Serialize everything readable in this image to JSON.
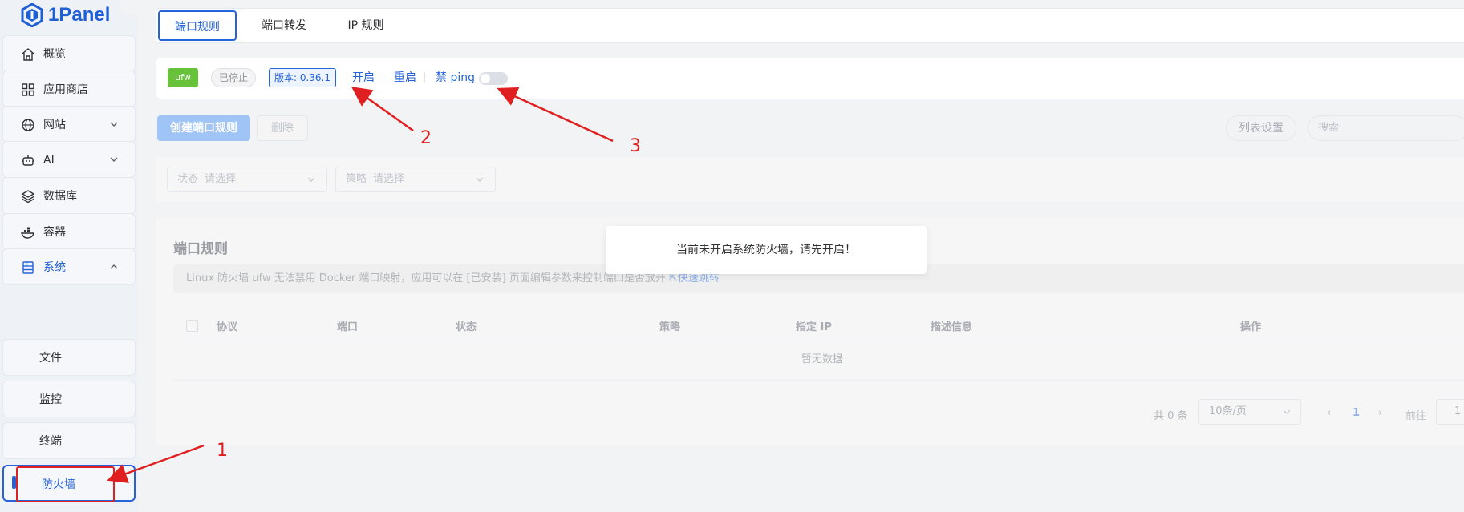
{
  "app": {
    "logo_text": "1Panel"
  },
  "colors": {
    "accent": "#2463d8",
    "success": "#67c23a",
    "annotation": "#e02020"
  },
  "sidebar": {
    "items": [
      {
        "label": "概览",
        "icon": "home-icon",
        "expandable": false
      },
      {
        "label": "应用商店",
        "icon": "grid-icon",
        "expandable": false
      },
      {
        "label": "网站",
        "icon": "globe-icon",
        "expandable": true
      },
      {
        "label": "AI",
        "icon": "robot-icon",
        "expandable": true
      },
      {
        "label": "数据库",
        "icon": "layers-icon",
        "expandable": false
      },
      {
        "label": "容器",
        "icon": "docker-icon",
        "expandable": false
      },
      {
        "label": "系统",
        "icon": "server-icon",
        "expandable": true,
        "expanded": true
      }
    ],
    "sub_items": [
      {
        "label": "文件"
      },
      {
        "label": "监控"
      },
      {
        "label": "终端"
      },
      {
        "label": "防火墙",
        "current": true
      }
    ]
  },
  "tabs": [
    {
      "label": "端口规则",
      "active": true
    },
    {
      "label": "端口转发"
    },
    {
      "label": "IP 规则"
    }
  ],
  "status": {
    "engine": "ufw",
    "state": "已停止",
    "version": "版本: 0.36.1",
    "start_link": "开启",
    "restart_link": "重启",
    "ping_label": "禁 ping",
    "ping_enabled": false
  },
  "toolbar": {
    "create_label": "创建端口规则",
    "delete_label": "删除",
    "list_settings_label": "列表设置",
    "search_placeholder": "搜索"
  },
  "filters": [
    {
      "prefix": "状态",
      "placeholder": "请选择"
    },
    {
      "prefix": "策略",
      "placeholder": "请选择"
    }
  ],
  "panel": {
    "title": "端口规则",
    "notice": "Linux 防火墙 ufw 无法禁用 Docker 端口映射，应用可以在 [已安装] 页面编辑参数来控制端口是否放开",
    "notice_link": "快速跳转",
    "columns": [
      "协议",
      "端口",
      "状态",
      "策略",
      "指定 IP",
      "描述信息",
      "操作"
    ],
    "empty_text": "暂无数据"
  },
  "pagination": {
    "total": "共 0 条",
    "page_size": "10条/页",
    "current_page": "1",
    "goto_label": "前往",
    "goto_value": "1"
  },
  "toast": {
    "message": "当前未开启系统防火墙，请先开启！"
  },
  "annotations": [
    "1",
    "2",
    "3"
  ]
}
